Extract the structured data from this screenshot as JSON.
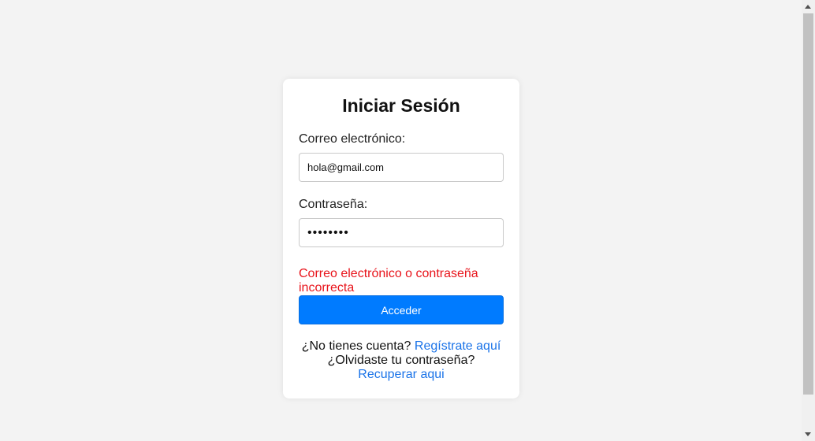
{
  "login": {
    "title": "Iniciar Sesión",
    "email_label": "Correo electrónico:",
    "email_value": "hola@gmail.com",
    "password_label": "Contraseña:",
    "password_value": "12345678",
    "error_message": "Correo electrónico o contraseña incorrecta",
    "submit_label": "Acceder",
    "no_account_text": "¿No tienes cuenta?",
    "register_link": "Regístrate aquí",
    "forgot_text": "¿Olvidaste tu contraseña?",
    "recover_link": "Recuperar aqui"
  },
  "colors": {
    "background": "#f3f3f3",
    "card": "#ffffff",
    "primary_button": "#007bff",
    "error": "#e8141b",
    "link": "#1a73e8"
  }
}
